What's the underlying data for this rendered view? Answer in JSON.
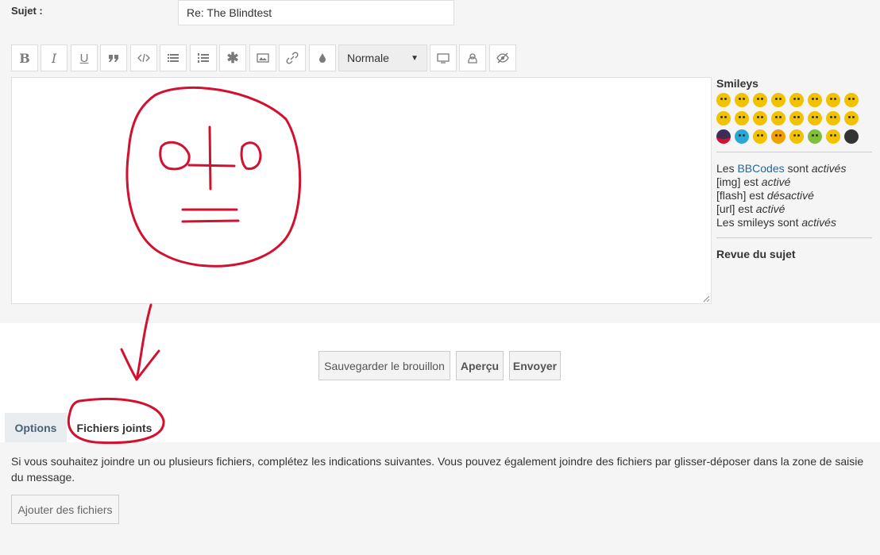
{
  "subject": {
    "label": "Sujet :",
    "value": "Re: The Blindtest"
  },
  "toolbar": {
    "buttons": [
      "bold-icon",
      "italic-icon",
      "underline-icon",
      "quote-icon",
      "code-icon",
      "list-icon",
      "ordered-list-icon",
      "list-item-icon",
      "image-icon",
      "link-icon",
      "color-icon"
    ],
    "font_size": "Normale",
    "after": [
      "monitor-icon",
      "user-icon",
      "eye-slash-icon"
    ]
  },
  "sidebar": {
    "smileys_title": "Smileys",
    "bbcodes": {
      "line1_prefix": "Les ",
      "line1_link": "BBCodes",
      "line1_mid": " sont ",
      "line1_state": "activés",
      "line2_prefix": "[img] est ",
      "line2_state": "activé",
      "line3_prefix": "[flash] est ",
      "line3_state": "désactivé",
      "line4_prefix": "[url] est ",
      "line4_state": "activé",
      "line5_prefix": "Les smileys sont ",
      "line5_state": "activés"
    },
    "revue": "Revue du sujet"
  },
  "actions": {
    "save_draft": "Sauvegarder le brouillon",
    "preview": "Aperçu",
    "submit": "Envoyer"
  },
  "tabs": {
    "options": "Options",
    "attachments": "Fichiers joints"
  },
  "attachments": {
    "help": "Si vous souhaitez joindre un ou plusieurs fichiers, complétez les indications suivantes. Vous pouvez également joindre des fichiers par glisser-déposer dans la zone de saisie du message.",
    "add_button": "Ajouter des fichiers"
  },
  "colors": {
    "annotation": "#d3112e",
    "smiley": "#f2c200"
  }
}
